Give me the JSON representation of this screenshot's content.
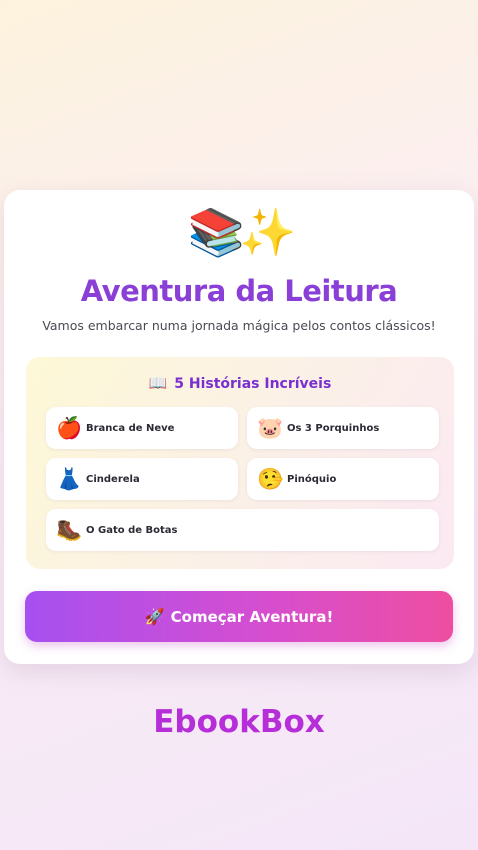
{
  "hero": {
    "emoji": "📚✨"
  },
  "title": "Aventura da Leitura",
  "subtitle": "Vamos embarcar numa jornada mágica pelos contos clássicos!",
  "stories": {
    "header_icon": "📖",
    "header": "5 Histórias Incríveis",
    "items": [
      {
        "emoji": "🍎",
        "label": "Branca de Neve"
      },
      {
        "emoji": "🐷",
        "label": "Os 3 Porquinhos"
      },
      {
        "emoji": "👗",
        "label": "Cinderela"
      },
      {
        "emoji": "🤥",
        "label": "Pinóquio"
      },
      {
        "emoji": "🥾",
        "label": "O Gato de Botas"
      }
    ]
  },
  "cta": {
    "emoji": "🚀",
    "label": "Começar Aventura!"
  },
  "brand": "EbookBox"
}
